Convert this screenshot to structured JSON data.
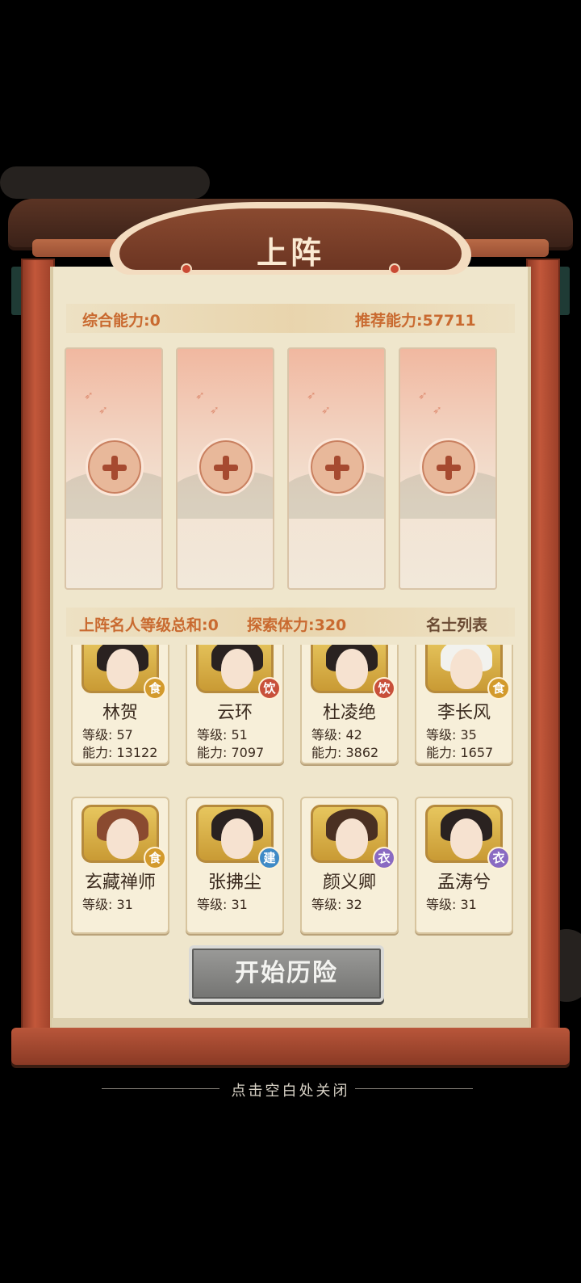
{
  "dialog": {
    "title": "上阵",
    "total_power_label": "综合能力:0",
    "recommended_power_label": "推荐能力:57711",
    "level_sum_label": "上阵名人等级总和:0",
    "stamina_label": "探索体力:320",
    "list_title": "名士列表"
  },
  "slots": [
    {
      "state": "empty"
    },
    {
      "state": "empty"
    },
    {
      "state": "empty"
    },
    {
      "state": "empty"
    }
  ],
  "heroes": [
    {
      "name": "林贺",
      "level": "等级: 57",
      "power": "能力: 13122",
      "badge": "食",
      "badge_color": "#d39a2c"
    },
    {
      "name": "云环",
      "level": "等级: 51",
      "power": "能力: 7097",
      "badge": "饮",
      "badge_color": "#c8503a"
    },
    {
      "name": "杜凌绝",
      "level": "等级: 42",
      "power": "能力: 3862",
      "badge": "饮",
      "badge_color": "#c8503a"
    },
    {
      "name": "李长风",
      "level": "等级: 35",
      "power": "能力: 1657",
      "badge": "食",
      "badge_color": "#d39a2c"
    },
    {
      "name": "玄藏禅师",
      "level": "等级: 31",
      "power": "",
      "badge": "食",
      "badge_color": "#d39a2c"
    },
    {
      "name": "张拂尘",
      "level": "等级: 31",
      "power": "",
      "badge": "建",
      "badge_color": "#3f8ac6"
    },
    {
      "name": "颜义卿",
      "level": "等级: 32",
      "power": "",
      "badge": "衣",
      "badge_color": "#8a6ac2"
    },
    {
      "name": "孟涛兮",
      "level": "等级: 31",
      "power": "",
      "badge": "衣",
      "badge_color": "#8a6ac2"
    }
  ],
  "start_button": "开始历险",
  "close_hint": "点击空白处关闭"
}
